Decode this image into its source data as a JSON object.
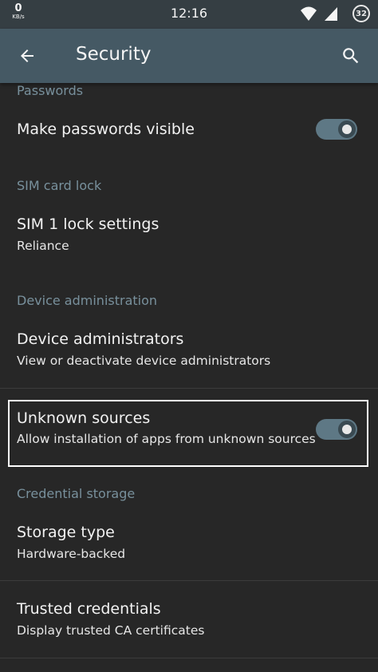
{
  "status_bar": {
    "speed_value": "0",
    "speed_unit": "KB/s",
    "time": "12:16",
    "battery": "32"
  },
  "toolbar": {
    "title": "Security"
  },
  "sections": {
    "passwords": {
      "header": "Passwords",
      "make_visible_title": "Make passwords visible",
      "make_visible_on": true
    },
    "sim": {
      "header": "SIM card lock",
      "sim1_title": "SIM 1 lock settings",
      "sim1_summary": "Reliance"
    },
    "device_admin": {
      "header": "Device administration",
      "admins_title": "Device administrators",
      "admins_summary": "View or deactivate device administrators",
      "unknown_title": "Unknown sources",
      "unknown_summary": "Allow installation of apps from unknown sources",
      "unknown_on": true
    },
    "credential": {
      "header": "Credential storage",
      "storage_title": "Storage type",
      "storage_summary": "Hardware-backed",
      "trusted_title": "Trusted credentials",
      "trusted_summary": "Display trusted CA certificates"
    }
  },
  "colors": {
    "toolbar": "#455964",
    "status_bar": "#353e43",
    "background": "#272727",
    "section_header": "#78909c",
    "toggle_track_on": "#5e7885"
  }
}
